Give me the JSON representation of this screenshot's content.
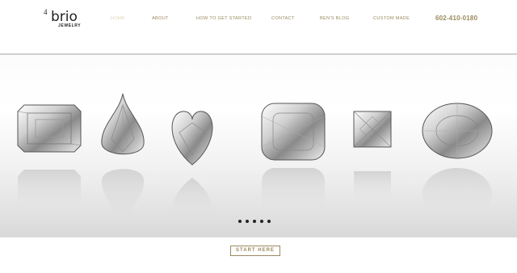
{
  "header": {
    "logo": {
      "number": "4",
      "word": "brio",
      "sub": "JEWELRY"
    },
    "nav": [
      {
        "label": "HOME",
        "active": true
      },
      {
        "label": "ABOUT",
        "active": false
      },
      {
        "label": "HOW TO GET STARTED",
        "active": false
      },
      {
        "label": "CONTACT",
        "active": false
      },
      {
        "label": "BEN'S BLOG",
        "active": false
      },
      {
        "label": "CUSTOM MADE",
        "active": false
      }
    ],
    "phone": "602-410-0180"
  },
  "slider": {
    "diamonds": [
      "emerald-cut-diamond",
      "pear-cut-diamond",
      "heart-cut-diamond",
      "cushion-cut-diamond",
      "princess-cut-diamond",
      "oval-cut-diamond"
    ],
    "dots": 5,
    "active_dot": 0
  },
  "cta": {
    "label": "START HERE"
  },
  "colors": {
    "accent": "#9a8a5e",
    "nav_active": "#e1d6b7"
  }
}
